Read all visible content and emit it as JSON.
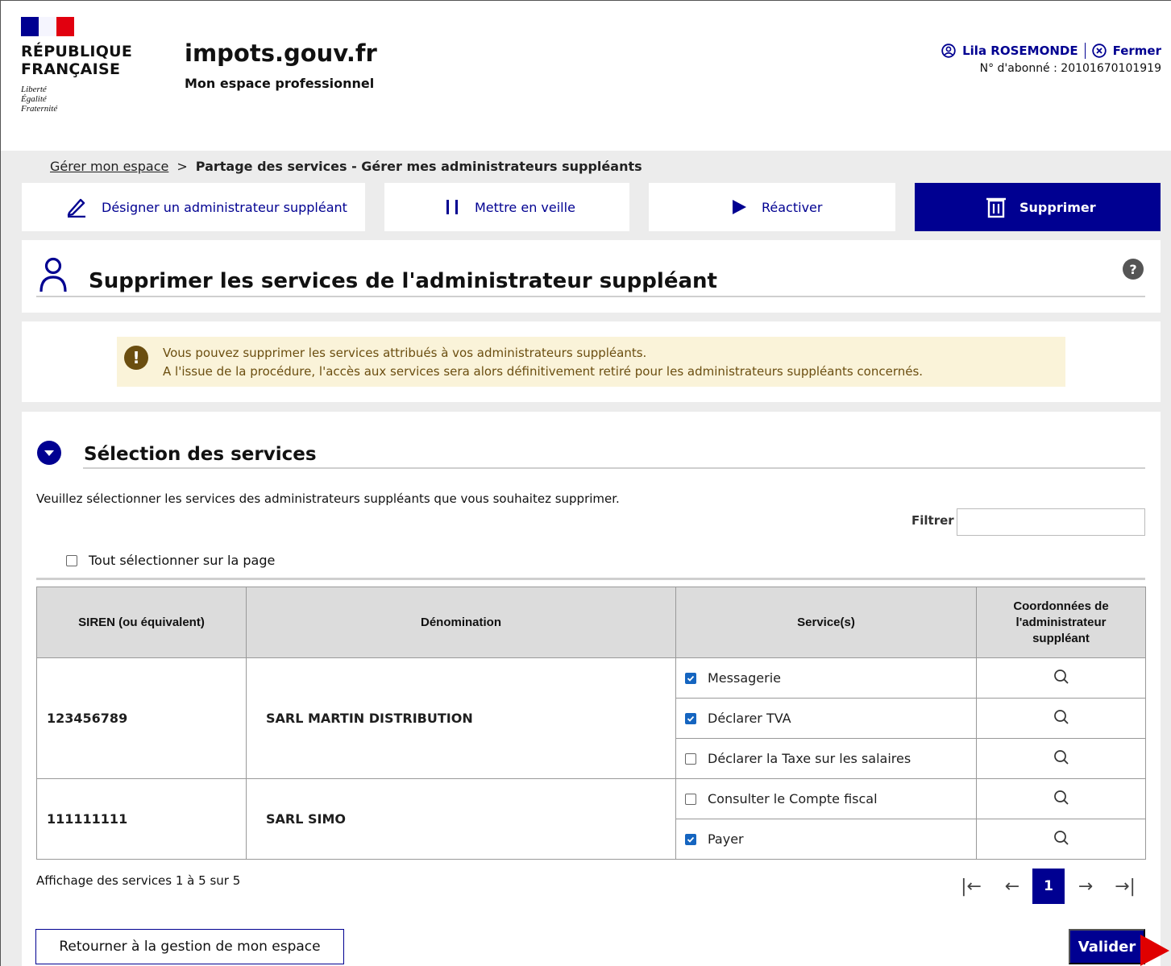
{
  "header": {
    "republic_line1": "RÉPUBLIQUE",
    "republic_line2": "FRANÇAISE",
    "motto": [
      "Liberté",
      "Égalité",
      "Fraternité"
    ],
    "brand": "impots.gouv.fr",
    "brand_sub": "Mon espace professionnel",
    "user_name": "Lila ROSEMONDE",
    "close_label": "Fermer",
    "subscriber": "N° d'abonné : 20101670101919"
  },
  "breadcrumb": {
    "link": "Gérer mon espace",
    "separator": ">",
    "current": "Partage des services - Gérer mes administrateurs suppléants"
  },
  "tabs": [
    {
      "label": "Désigner un administrateur suppléant",
      "icon": "pencil-icon",
      "active": false
    },
    {
      "label": "Mettre en veille",
      "icon": "pause-icon",
      "active": false
    },
    {
      "label": "Réactiver",
      "icon": "play-icon",
      "active": false
    },
    {
      "label": "Supprimer",
      "icon": "trash-icon",
      "active": true
    }
  ],
  "page": {
    "title": "Supprimer les services de l'administrateur suppléant",
    "help": "?"
  },
  "alert": {
    "icon": "!",
    "line1": "Vous pouvez supprimer les services attribués à vos administrateurs suppléants.",
    "line2": "A l'issue de la procédure, l'accès aux services sera alors définitivement retiré pour les administrateurs suppléants concernés."
  },
  "section": {
    "title": "Sélection des services",
    "instruction": "Veuillez sélectionner les services des administrateurs suppléants que vous souhaitez supprimer.",
    "filter_label": "Filtrer",
    "filter_value": "",
    "select_all_label": "Tout sélectionner sur la page"
  },
  "table": {
    "headers": [
      "SIREN (ou équivalent)",
      "Dénomination",
      "Service(s)",
      "Coordonnées de l'administrateur suppléant"
    ],
    "groups": [
      {
        "siren": "123456789",
        "name": "SARL MARTIN DISTRIBUTION",
        "services": [
          {
            "label": "Messagerie",
            "checked": true
          },
          {
            "label": "Déclarer TVA",
            "checked": true
          },
          {
            "label": "Déclarer la Taxe sur les salaires",
            "checked": false
          }
        ]
      },
      {
        "siren": "111111111",
        "name": "SARL SIMO",
        "services": [
          {
            "label": "Consulter le Compte fiscal",
            "checked": false
          },
          {
            "label": "Payer",
            "checked": true
          }
        ]
      }
    ]
  },
  "pagination": {
    "summary": "Affichage des services 1 à 5 sur 5",
    "current_page": "1",
    "first": "|←",
    "prev": "←",
    "next": "→",
    "last": "→|"
  },
  "actions": {
    "back": "Retourner à la gestion de mon espace",
    "validate": "Valider"
  },
  "colors": {
    "primary": "#000091",
    "alert_bg": "#faf3d9",
    "alert_text": "#6b4e10",
    "checkbox": "#1565c0",
    "flag_red": "#e1000f"
  }
}
